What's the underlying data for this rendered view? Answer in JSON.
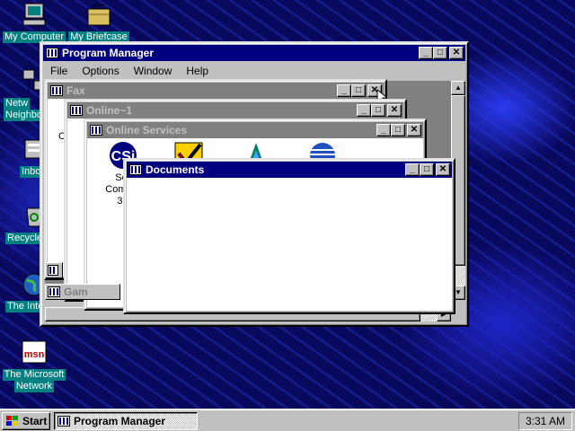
{
  "desktop": {
    "icons": [
      {
        "label": "My Computer",
        "icon": "computer-icon"
      },
      {
        "label": "My Briefcase",
        "icon": "briefcase-icon"
      },
      {
        "label": "Netw",
        "label2": "Neighbo",
        "icon": "network-icon"
      },
      {
        "label": "Inbo",
        "icon": "inbox-icon"
      },
      {
        "label": "Recycle",
        "icon": "recycle-bin-icon"
      },
      {
        "label": "The Inte",
        "icon": "internet-globe-icon"
      },
      {
        "label": "The Microsoft",
        "label2": "Network",
        "icon": "msn-icon"
      }
    ]
  },
  "program_manager": {
    "title": "Program Manager",
    "menu": [
      "File",
      "Options",
      "Window",
      "Help"
    ],
    "menu_hotkeys": [
      "F",
      "O",
      "W",
      "H"
    ]
  },
  "windows": {
    "fax": {
      "title": "Fax",
      "partial_left": "C",
      "partial_left2": "Co"
    },
    "online1": {
      "title": "Online~1"
    },
    "online_services": {
      "title": "Online Services",
      "items": [
        {
          "icon": "compuserve-icon",
          "label_lines": [
            "Se",
            "Compu",
            "3."
          ]
        },
        {
          "icon": "att-worldnet-icon",
          "label_lines": []
        },
        {
          "icon": "prodigy-icon",
          "label_lines": []
        },
        {
          "icon": "att-globe-icon",
          "label_lines": []
        }
      ]
    },
    "documents": {
      "title": "Documents"
    },
    "minimized": [
      {
        "title": "Gam"
      }
    ]
  },
  "taskbar": {
    "start_label": "Start",
    "task_label": "Program Manager",
    "clock": "3:31 AM"
  },
  "colors": {
    "active_title": "#000080",
    "inactive_title": "#808080",
    "desktop": "#08085c",
    "face": "#c0c0c0"
  }
}
